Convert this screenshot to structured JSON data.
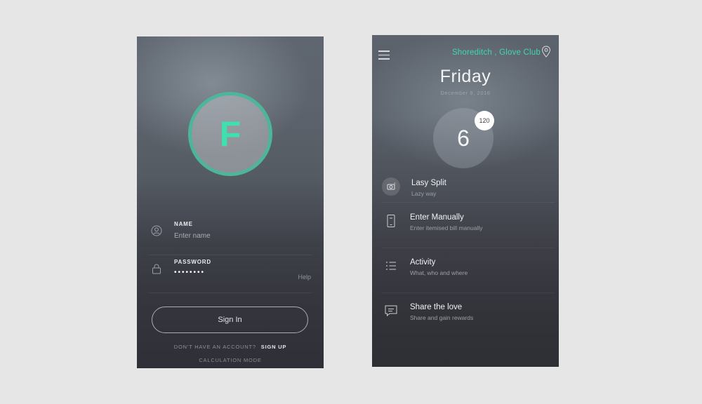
{
  "login": {
    "avatar_letter": "F",
    "name_label": "NAME",
    "name_placeholder": "Enter name",
    "password_label": "PASSWORD",
    "password_value": "••••••••",
    "help_label": "Help",
    "signin_label": "Sign In",
    "no_account_text": "DON'T HAVE AN ACCOUNT?",
    "signup_label": "SIGN UP",
    "calc_mode_label": "CALCULATION MODE"
  },
  "home": {
    "location": "Shoreditch , Glove Club",
    "day": "Friday",
    "date": "December 9, 2016",
    "count": "6",
    "badge": "120",
    "menu": [
      {
        "title": "Lasy Split",
        "subtitle": "Lazy way",
        "icon": "camera-icon"
      },
      {
        "title": "Enter Manually",
        "subtitle": "Enter itemised bill manually",
        "icon": "phone-icon"
      },
      {
        "title": "Activity",
        "subtitle": "What, who and where",
        "icon": "list-icon"
      },
      {
        "title": "Share the love",
        "subtitle": "Share and gain rewards",
        "icon": "chat-icon"
      }
    ]
  },
  "colors": {
    "accent": "#3ed8ae",
    "ring": "#4db59a",
    "background": "#e6e6e6"
  }
}
